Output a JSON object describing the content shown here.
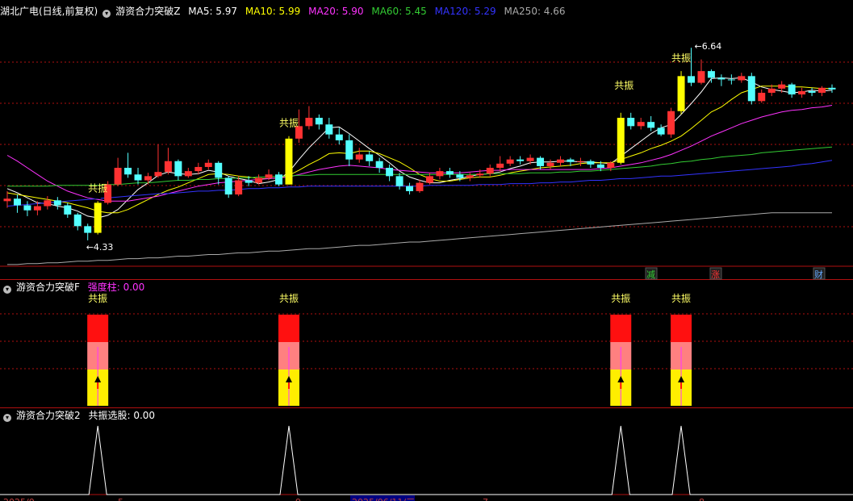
{
  "main_header": {
    "stock": "湖北广电(日线,前复权)",
    "indicator": "游资合力突破Z",
    "ma": [
      {
        "label": "MA5: 5.97",
        "color": "#ffffff"
      },
      {
        "label": "MA10: 5.99",
        "color": "#ffff00"
      },
      {
        "label": "MA20: 5.90",
        "color": "#ff33ff"
      },
      {
        "label": "MA60: 5.45",
        "color": "#33cc33"
      },
      {
        "label": "MA120: 5.29",
        "color": "#3333ff"
      },
      {
        "label": "MA250: 4.66",
        "color": "#aaaaaa"
      }
    ]
  },
  "panel2_header": {
    "indicator": "游资合力突破F",
    "field": "强度柱: 0.00",
    "field_color": "#ff33ff"
  },
  "panel3_header": {
    "indicator": "游资合力突破2",
    "field": "共振选股: 0.00",
    "field_color": "#ffffff"
  },
  "annotations": {
    "resonance": "共振",
    "low": "4.33",
    "high": "6.64"
  },
  "markers": [
    {
      "text": "减",
      "color": "#33cc33"
    },
    {
      "text": "涨",
      "color": "#ff3333"
    },
    {
      "text": "财",
      "color": "#66aaff"
    }
  ],
  "axis_dates": [
    "2025/0",
    "5",
    "9",
    "2025/06/11/三",
    "7",
    "8"
  ],
  "colors": {
    "up": "#ff3232",
    "down": "#54ffff",
    "signal": "#ffff00",
    "grid": "#b01010"
  },
  "chart_data": {
    "type": "candlestick",
    "price_range": [
      4.0,
      7.0
    ],
    "resonance_indices": [
      9,
      28,
      61,
      67
    ],
    "candles": [
      [
        4.8,
        4.83,
        4.92,
        4.72
      ],
      [
        4.83,
        4.75,
        4.88,
        4.66
      ],
      [
        4.75,
        4.69,
        4.8,
        4.62
      ],
      [
        4.69,
        4.74,
        4.8,
        4.63
      ],
      [
        4.74,
        4.81,
        4.86,
        4.7
      ],
      [
        4.81,
        4.75,
        4.85,
        4.7
      ],
      [
        4.75,
        4.64,
        4.78,
        4.6
      ],
      [
        4.64,
        4.5,
        4.66,
        4.45
      ],
      [
        4.5,
        4.42,
        4.53,
        4.33
      ],
      [
        4.42,
        4.78,
        4.8,
        4.4
      ],
      [
        4.78,
        5.0,
        5.04,
        4.76
      ],
      [
        5.0,
        5.2,
        5.32,
        4.98
      ],
      [
        5.2,
        5.12,
        5.38,
        5.08
      ],
      [
        5.12,
        5.05,
        5.2,
        5.0
      ],
      [
        5.05,
        5.1,
        5.14,
        5.0
      ],
      [
        5.1,
        5.15,
        5.48,
        5.08
      ],
      [
        5.15,
        5.28,
        5.44,
        5.12
      ],
      [
        5.28,
        5.1,
        5.3,
        5.05
      ],
      [
        5.1,
        5.16,
        5.2,
        5.08
      ],
      [
        5.16,
        5.21,
        5.26,
        5.12
      ],
      [
        5.21,
        5.26,
        5.3,
        5.18
      ],
      [
        5.26,
        5.08,
        5.28,
        5.0
      ],
      [
        5.08,
        4.88,
        5.1,
        4.84
      ],
      [
        4.88,
        5.05,
        5.1,
        4.86
      ],
      [
        5.05,
        5.02,
        5.1,
        4.98
      ],
      [
        5.02,
        5.08,
        5.12,
        5.0
      ],
      [
        5.08,
        5.12,
        5.18,
        5.05
      ],
      [
        5.12,
        5.0,
        5.15,
        4.98
      ],
      [
        5.0,
        5.55,
        5.58,
        5.0
      ],
      [
        5.55,
        5.7,
        5.9,
        5.5
      ],
      [
        5.7,
        5.8,
        5.94,
        5.66
      ],
      [
        5.8,
        5.72,
        5.84,
        5.66
      ],
      [
        5.72,
        5.6,
        5.8,
        5.55
      ],
      [
        5.6,
        5.53,
        5.68,
        5.48
      ],
      [
        5.53,
        5.3,
        5.6,
        5.22
      ],
      [
        5.3,
        5.36,
        5.44,
        5.26
      ],
      [
        5.36,
        5.28,
        5.4,
        5.22
      ],
      [
        5.28,
        5.2,
        5.32,
        5.14
      ],
      [
        5.2,
        5.1,
        5.24,
        5.04
      ],
      [
        5.1,
        4.98,
        5.14,
        4.94
      ],
      [
        4.98,
        4.92,
        5.02,
        4.88
      ],
      [
        4.92,
        5.02,
        5.06,
        4.9
      ],
      [
        5.02,
        5.1,
        5.14,
        5.0
      ],
      [
        5.1,
        5.16,
        5.2,
        5.06
      ],
      [
        5.16,
        5.12,
        5.2,
        5.08
      ],
      [
        5.12,
        5.08,
        5.16,
        5.04
      ],
      [
        5.08,
        5.11,
        5.14,
        5.04
      ],
      [
        5.11,
        5.13,
        5.18,
        5.08
      ],
      [
        5.13,
        5.2,
        5.24,
        5.1
      ],
      [
        5.2,
        5.25,
        5.34,
        5.16
      ],
      [
        5.25,
        5.3,
        5.34,
        5.22
      ],
      [
        5.3,
        5.28,
        5.34,
        5.24
      ],
      [
        5.28,
        5.32,
        5.36,
        5.24
      ],
      [
        5.32,
        5.22,
        5.34,
        5.18
      ],
      [
        5.22,
        5.26,
        5.3,
        5.18
      ],
      [
        5.26,
        5.3,
        5.34,
        5.22
      ],
      [
        5.3,
        5.27,
        5.32,
        5.22
      ],
      [
        5.27,
        5.28,
        5.32,
        5.22
      ],
      [
        5.28,
        5.24,
        5.3,
        5.2
      ],
      [
        5.24,
        5.2,
        5.28,
        5.16
      ],
      [
        5.2,
        5.26,
        5.28,
        5.16
      ],
      [
        5.26,
        5.8,
        5.86,
        5.24
      ],
      [
        5.8,
        5.7,
        5.86,
        5.66
      ],
      [
        5.7,
        5.75,
        5.8,
        5.66
      ],
      [
        5.75,
        5.68,
        5.82,
        5.64
      ],
      [
        5.68,
        5.6,
        5.72,
        5.58
      ],
      [
        5.6,
        5.88,
        5.92,
        5.56
      ],
      [
        5.88,
        6.3,
        6.36,
        5.84
      ],
      [
        6.3,
        6.22,
        6.64,
        6.18
      ],
      [
        6.22,
        6.36,
        6.5,
        6.2
      ],
      [
        6.36,
        6.28,
        6.38,
        6.22
      ],
      [
        6.28,
        6.26,
        6.32,
        6.18
      ],
      [
        6.26,
        6.25,
        6.32,
        6.2
      ],
      [
        6.25,
        6.3,
        6.34,
        6.22
      ],
      [
        6.3,
        6.0,
        6.34,
        5.96
      ],
      [
        6.0,
        6.1,
        6.14,
        5.98
      ],
      [
        6.1,
        6.15,
        6.2,
        6.06
      ],
      [
        6.15,
        6.2,
        6.24,
        6.1
      ],
      [
        6.2,
        6.08,
        6.22,
        6.04
      ],
      [
        6.08,
        6.12,
        6.16,
        6.04
      ],
      [
        6.12,
        6.1,
        6.16,
        6.06
      ],
      [
        6.1,
        6.16,
        6.18,
        6.06
      ],
      [
        6.16,
        6.14,
        6.2,
        6.1
      ]
    ],
    "series": [
      {
        "name": "MA5",
        "color": "#ffffff",
        "values": [
          4.95,
          4.9,
          4.84,
          4.78,
          4.77,
          4.74,
          4.72,
          4.68,
          4.62,
          4.6,
          4.63,
          4.7,
          4.82,
          4.94,
          5.02,
          5.11,
          5.15,
          5.13,
          5.12,
          5.13,
          5.17,
          5.15,
          5.1,
          5.07,
          5.05,
          5.01,
          5.03,
          5.06,
          5.15,
          5.3,
          5.44,
          5.56,
          5.68,
          5.69,
          5.61,
          5.52,
          5.43,
          5.35,
          5.26,
          5.16,
          5.09,
          5.05,
          5.02,
          5.02,
          5.05,
          5.07,
          5.1,
          5.12,
          5.13,
          5.15,
          5.19,
          5.22,
          5.26,
          5.27,
          5.27,
          5.28,
          5.28,
          5.27,
          5.27,
          5.26,
          5.25,
          5.34,
          5.43,
          5.52,
          5.61,
          5.68,
          5.72,
          5.84,
          5.97,
          6.11,
          6.27,
          6.28,
          6.27,
          6.28,
          6.23,
          6.17,
          6.14,
          6.12,
          6.1,
          6.11,
          6.13,
          6.12,
          6.13
        ]
      },
      {
        "name": "MA10",
        "color": "#ffff00",
        "values": [
          4.9,
          4.88,
          4.86,
          4.84,
          4.82,
          4.8,
          4.78,
          4.75,
          4.72,
          4.68,
          4.66,
          4.66,
          4.7,
          4.76,
          4.82,
          4.88,
          4.93,
          4.97,
          5.02,
          5.07,
          5.12,
          5.13,
          5.12,
          5.1,
          5.09,
          5.07,
          5.07,
          5.08,
          5.11,
          5.17,
          5.24,
          5.3,
          5.37,
          5.38,
          5.37,
          5.4,
          5.4,
          5.37,
          5.32,
          5.27,
          5.2,
          5.12,
          5.07,
          5.04,
          5.04,
          5.06,
          5.08,
          5.09,
          5.09,
          5.11,
          5.14,
          5.16,
          5.18,
          5.2,
          5.21,
          5.22,
          5.23,
          5.25,
          5.26,
          5.26,
          5.26,
          5.3,
          5.34,
          5.38,
          5.43,
          5.47,
          5.52,
          5.58,
          5.67,
          5.77,
          5.87,
          5.93,
          6.02,
          6.1,
          6.14,
          6.18,
          6.18,
          6.18,
          6.17,
          6.17,
          6.16,
          6.15,
          6.15
        ]
      },
      {
        "name": "MA20",
        "color": "#ff33ff",
        "values": [
          5.35,
          5.28,
          5.2,
          5.12,
          5.04,
          4.98,
          4.92,
          4.88,
          4.84,
          4.82,
          4.8,
          4.8,
          4.8,
          4.82,
          4.84,
          4.86,
          4.89,
          4.92,
          4.95,
          4.98,
          5.0,
          5.02,
          5.03,
          5.04,
          5.05,
          5.06,
          5.07,
          5.08,
          5.09,
          5.12,
          5.15,
          5.18,
          5.2,
          5.22,
          5.23,
          5.22,
          5.21,
          5.2,
          5.18,
          5.17,
          5.16,
          5.15,
          5.14,
          5.14,
          5.14,
          5.14,
          5.15,
          5.16,
          5.17,
          5.17,
          5.18,
          5.18,
          5.18,
          5.18,
          5.18,
          5.18,
          5.18,
          5.18,
          5.18,
          5.19,
          5.2,
          5.22,
          5.24,
          5.26,
          5.29,
          5.32,
          5.36,
          5.41,
          5.46,
          5.52,
          5.58,
          5.63,
          5.68,
          5.73,
          5.77,
          5.81,
          5.84,
          5.87,
          5.89,
          5.9,
          5.92,
          5.93,
          5.95
        ]
      },
      {
        "name": "MA60",
        "color": "#33cc33",
        "values": [
          4.98,
          4.98,
          4.98,
          4.98,
          4.98,
          4.99,
          4.99,
          4.99,
          4.99,
          4.99,
          5.0,
          5.0,
          5.01,
          5.02,
          5.02,
          5.03,
          5.04,
          5.05,
          5.05,
          5.06,
          5.06,
          5.07,
          5.07,
          5.08,
          5.08,
          5.09,
          5.09,
          5.1,
          5.1,
          5.11,
          5.11,
          5.12,
          5.12,
          5.12,
          5.12,
          5.12,
          5.12,
          5.12,
          5.12,
          5.12,
          5.12,
          5.12,
          5.12,
          5.12,
          5.12,
          5.12,
          5.12,
          5.12,
          5.13,
          5.13,
          5.13,
          5.13,
          5.14,
          5.14,
          5.14,
          5.15,
          5.15,
          5.16,
          5.16,
          5.17,
          5.18,
          5.19,
          5.2,
          5.21,
          5.22,
          5.24,
          5.25,
          5.27,
          5.28,
          5.3,
          5.31,
          5.33,
          5.34,
          5.35,
          5.36,
          5.38,
          5.39,
          5.4,
          5.41,
          5.42,
          5.43,
          5.44,
          5.45
        ]
      },
      {
        "name": "MA120",
        "color": "#3333ff",
        "values": [
          4.74,
          4.75,
          4.76,
          4.77,
          4.78,
          4.79,
          4.8,
          4.81,
          4.82,
          4.83,
          4.84,
          4.85,
          4.86,
          4.87,
          4.88,
          4.89,
          4.89,
          4.9,
          4.91,
          4.92,
          4.92,
          4.93,
          4.93,
          4.94,
          4.95,
          4.95,
          4.96,
          4.96,
          4.97,
          4.97,
          4.98,
          4.98,
          4.98,
          4.98,
          4.98,
          4.98,
          4.98,
          4.98,
          4.98,
          4.98,
          4.98,
          4.98,
          4.99,
          4.99,
          4.99,
          4.99,
          4.99,
          5.0,
          5.0,
          5.0,
          5.01,
          5.01,
          5.01,
          5.02,
          5.02,
          5.03,
          5.03,
          5.04,
          5.05,
          5.05,
          5.06,
          5.07,
          5.07,
          5.08,
          5.09,
          5.1,
          5.1,
          5.11,
          5.12,
          5.13,
          5.14,
          5.15,
          5.16,
          5.17,
          5.18,
          5.19,
          5.2,
          5.21,
          5.22,
          5.24,
          5.25,
          5.27,
          5.29
        ]
      },
      {
        "name": "MA250",
        "color": "#aaaaaa",
        "values": [
          4.04,
          4.04,
          4.05,
          4.05,
          4.06,
          4.06,
          4.07,
          4.08,
          4.08,
          4.09,
          4.09,
          4.1,
          4.11,
          4.11,
          4.12,
          4.12,
          4.13,
          4.14,
          4.14,
          4.15,
          4.16,
          4.16,
          4.17,
          4.18,
          4.18,
          4.19,
          4.2,
          4.2,
          4.21,
          4.22,
          4.23,
          4.23,
          4.24,
          4.25,
          4.26,
          4.27,
          4.27,
          4.28,
          4.29,
          4.3,
          4.31,
          4.31,
          4.32,
          4.33,
          4.34,
          4.35,
          4.36,
          4.37,
          4.38,
          4.39,
          4.4,
          4.41,
          4.42,
          4.43,
          4.44,
          4.45,
          4.46,
          4.47,
          4.48,
          4.49,
          4.5,
          4.51,
          4.52,
          4.53,
          4.54,
          4.55,
          4.56,
          4.57,
          4.58,
          4.59,
          4.6,
          4.61,
          4.62,
          4.63,
          4.64,
          4.65,
          4.66,
          4.66,
          4.66,
          4.66,
          4.66,
          4.66,
          4.66
        ]
      }
    ]
  }
}
